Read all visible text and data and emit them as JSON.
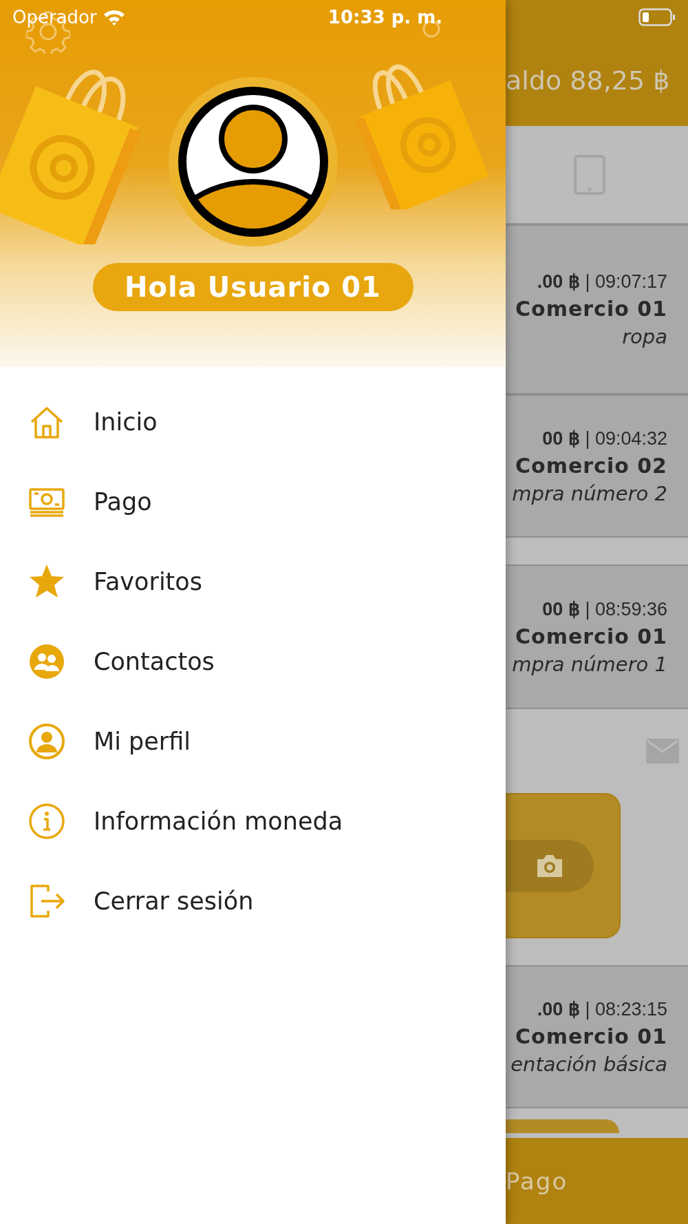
{
  "status_bar": {
    "carrier": "Operador",
    "time": "10:33 p. m."
  },
  "drawer": {
    "greeting": "Hola Usuario 01",
    "menu": [
      {
        "label": "Inicio"
      },
      {
        "label": "Pago"
      },
      {
        "label": "Favoritos"
      },
      {
        "label": "Contactos"
      },
      {
        "label": "Mi perfil"
      },
      {
        "label": "Información moneda"
      },
      {
        "label": "Cerrar sesión"
      }
    ]
  },
  "background_screen": {
    "balance": "aldo 88,25 ฿",
    "transactions": [
      {
        "amount_time": "**.00 ฿** | 09:07:17",
        "merchant": "Comercio 01",
        "description": "ropa"
      },
      {
        "amount_time": "**00 ฿** | 09:04:32",
        "merchant": "Comercio 02",
        "description": "mpra número 2"
      },
      {
        "amount_time": "**00 ฿** | 08:59:36",
        "merchant": "Comercio 01",
        "description": "mpra número 1"
      },
      {
        "amount_time": "**.00 ฿** | 08:23:15",
        "merchant": "Comercio 01",
        "description": "entación básica"
      }
    ],
    "bottom_tab": "Pago"
  }
}
